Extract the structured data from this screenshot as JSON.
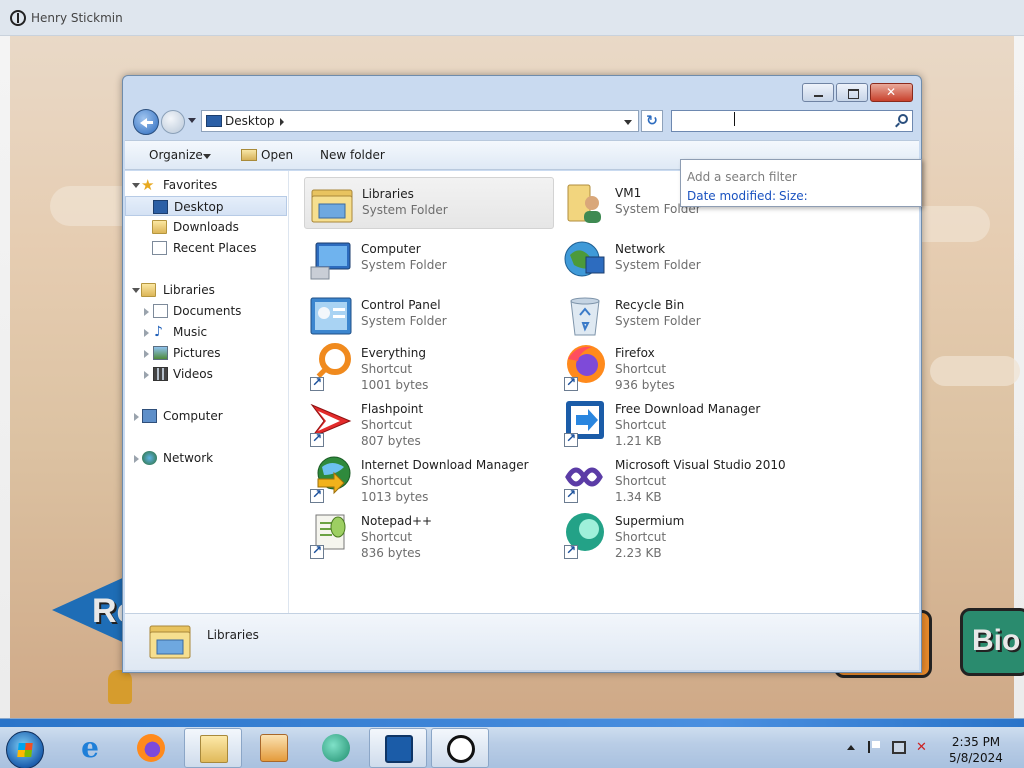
{
  "game": {
    "title": "Henry Stickmin",
    "left_button_text": "Re",
    "right_button_text": "Bio"
  },
  "dialog": {
    "address": {
      "crumb": "Desktop"
    },
    "search": {
      "value": "",
      "placeholder": ""
    },
    "suggestions": {
      "hint": "Add a search filter",
      "filters": [
        "Date modified:",
        "Size:"
      ]
    },
    "toolbar": {
      "organize": "Organize",
      "open": "Open",
      "new_folder": "New folder"
    },
    "nav": {
      "favorites": "Favorites",
      "desktop": "Desktop",
      "downloads": "Downloads",
      "recent_places": "Recent Places",
      "libraries": "Libraries",
      "documents": "Documents",
      "music": "Music",
      "pictures": "Pictures",
      "videos": "Videos",
      "computer": "Computer",
      "network": "Network"
    },
    "files": [
      {
        "name": "Libraries",
        "type": "System Folder",
        "size": ""
      },
      {
        "name": "VM1",
        "type": "System Folder",
        "size": ""
      },
      {
        "name": "Computer",
        "type": "System Folder",
        "size": ""
      },
      {
        "name": "Network",
        "type": "System Folder",
        "size": ""
      },
      {
        "name": "Control Panel",
        "type": "System Folder",
        "size": ""
      },
      {
        "name": "Recycle Bin",
        "type": "System Folder",
        "size": ""
      },
      {
        "name": "Everything",
        "type": "Shortcut",
        "size": "1001 bytes"
      },
      {
        "name": "Firefox",
        "type": "Shortcut",
        "size": "936 bytes"
      },
      {
        "name": "Flashpoint",
        "type": "Shortcut",
        "size": "807 bytes"
      },
      {
        "name": "Free Download Manager",
        "type": "Shortcut",
        "size": "1.21 KB"
      },
      {
        "name": "Internet Download Manager",
        "type": "Shortcut",
        "size": "1013 bytes"
      },
      {
        "name": "Microsoft Visual Studio 2010",
        "type": "Shortcut",
        "size": "1.34 KB"
      },
      {
        "name": "Notepad++",
        "type": "Shortcut",
        "size": "836 bytes"
      },
      {
        "name": "Supermium",
        "type": "Shortcut",
        "size": "2.23 KB"
      }
    ],
    "details": {
      "name": "Libraries"
    }
  },
  "taskbar": {
    "time": "2:35 PM",
    "date": "5/8/2024"
  }
}
